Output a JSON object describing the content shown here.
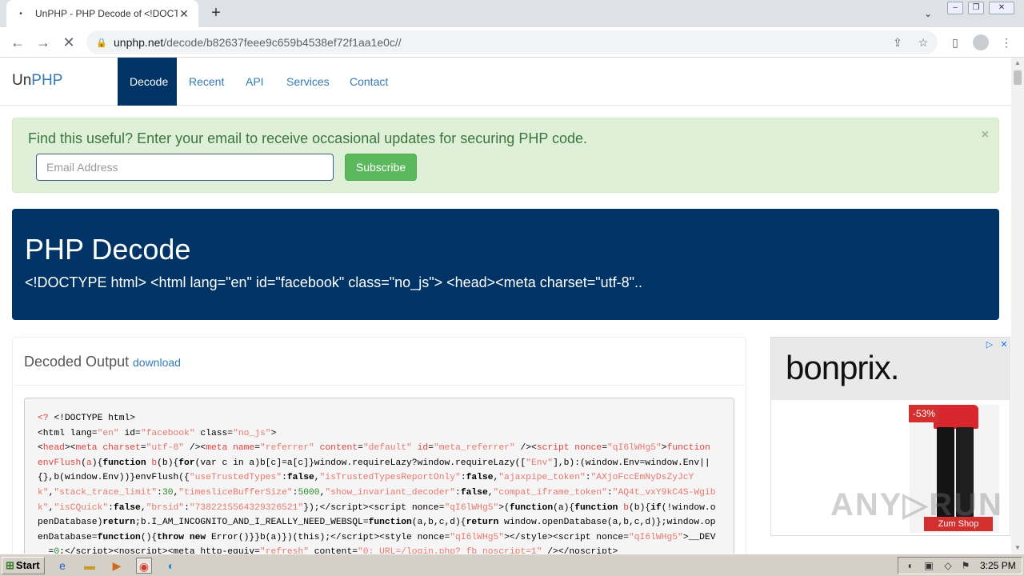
{
  "browser": {
    "tab_title": "UnPHP - PHP Decode of <!DOCTYPE",
    "tab_close": "✕",
    "new_tab": "+",
    "url_host": "unphp.net",
    "url_path": "/decode/b82637feee9c659b4538ef72f1aa1e0c//"
  },
  "site": {
    "brand_prefix": "Un",
    "brand_accent": "PHP",
    "nav": [
      "Decode",
      "Recent",
      "API",
      "Services",
      "Contact"
    ],
    "alert": {
      "message": "Find this useful? Enter your email to receive occasional updates for securing PHP code.",
      "close": "×",
      "email_placeholder": "Email Address",
      "subscribe_label": "Subscribe"
    },
    "jumbotron": {
      "title": "PHP Decode",
      "subtitle": "<!DOCTYPE html> <html lang=\"en\" id=\"facebook\" class=\"no_js\"> <head><meta charset=\"utf-8\".."
    },
    "output": {
      "title": "Decoded Output",
      "download_label": "download"
    },
    "ad": {
      "brand": "bonprix.",
      "discount": "-53%",
      "cta": "Zum Shop"
    },
    "watermark": "ANY.RUN"
  },
  "taskbar": {
    "start_label": "Start",
    "clock": "3:25 PM"
  },
  "colors": {
    "nav_active": "#003366",
    "link": "#337ab7",
    "alert_bg": "#dff0d8",
    "alert_text": "#3c763d",
    "subscribe": "#5cb85c",
    "ad_red": "#d32f2f"
  }
}
